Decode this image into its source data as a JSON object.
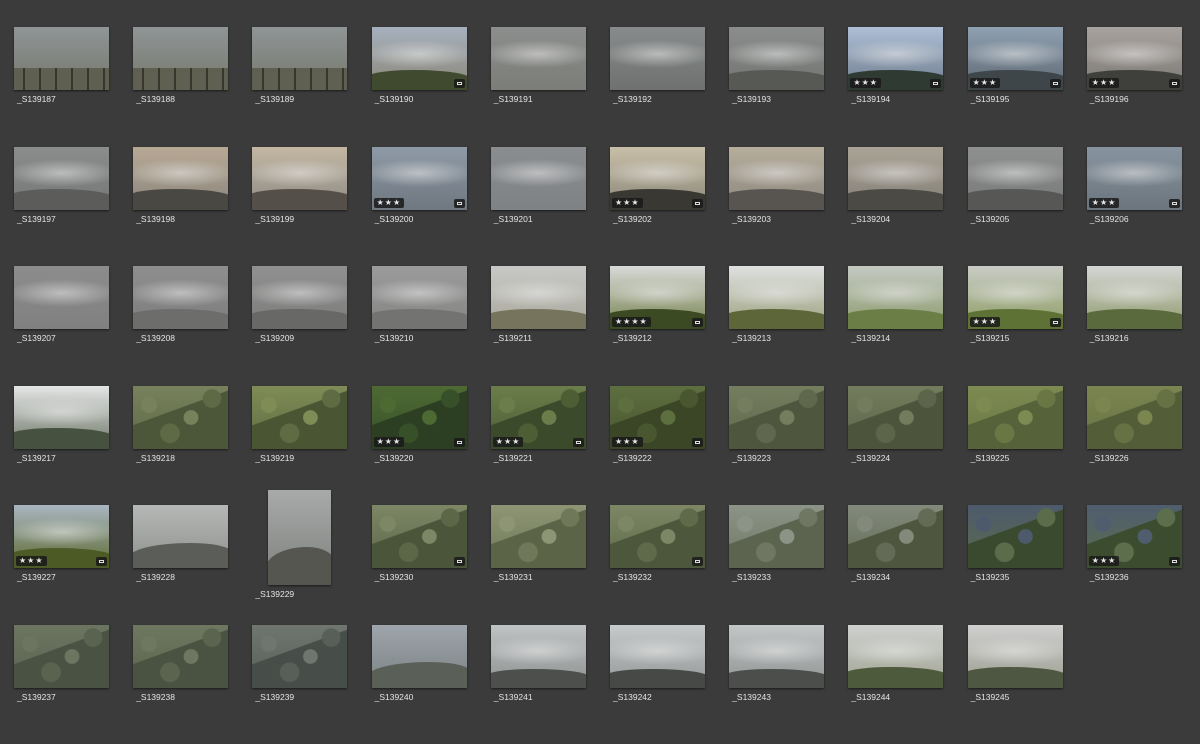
{
  "items": [
    {
      "name": "_S139187",
      "stars": "",
      "badge": false,
      "c": [
        "#8f9596",
        "#76786c"
      ],
      "h": "#5f5f52",
      "scene": "fence"
    },
    {
      "name": "_S139188",
      "stars": "",
      "badge": false,
      "c": [
        "#8f9596",
        "#76786c"
      ],
      "h": "#5f5f52",
      "scene": "fence"
    },
    {
      "name": "_S139189",
      "stars": "",
      "badge": false,
      "c": [
        "#8f9596",
        "#76786c"
      ],
      "h": "#5f5f52",
      "scene": "fence"
    },
    {
      "name": "_S139190",
      "stars": "",
      "badge": true,
      "c": [
        "#a6b0be",
        "#8b8676"
      ],
      "h": "#3f4a2e",
      "scene": "hills"
    },
    {
      "name": "_S139191",
      "stars": "",
      "badge": false,
      "c": [
        "#8c8e8d",
        "#7b7d78"
      ],
      "h": "#6e706b",
      "scene": "fog"
    },
    {
      "name": "_S139192",
      "stars": "",
      "badge": false,
      "c": [
        "#888b8c",
        "#6f7170"
      ],
      "h": "#555855",
      "scene": "fog"
    },
    {
      "name": "_S139193",
      "stars": "",
      "badge": false,
      "c": [
        "#8a8d8c",
        "#727471"
      ],
      "h": "#575a54",
      "scene": "trees"
    },
    {
      "name": "_S139194",
      "stars": "★★★",
      "badge": true,
      "c": [
        "#aebfd6",
        "#6e7c8c"
      ],
      "h": "#2f3a33",
      "scene": "trees"
    },
    {
      "name": "_S139195",
      "stars": "★★★",
      "badge": true,
      "c": [
        "#8fa0b2",
        "#5f6a73"
      ],
      "h": "#3e464a",
      "scene": "hills"
    },
    {
      "name": "_S139196",
      "stars": "★★★",
      "badge": true,
      "c": [
        "#a8a29e",
        "#7b7874"
      ],
      "h": "#3f403b",
      "scene": "hills"
    },
    {
      "name": "_S139197",
      "stars": "",
      "badge": false,
      "c": [
        "#8b8c8c",
        "#757676"
      ],
      "h": "#5c5d5b",
      "scene": "trees"
    },
    {
      "name": "_S139198",
      "stars": "",
      "badge": false,
      "c": [
        "#b8a994",
        "#8a857d"
      ],
      "h": "#4a4843",
      "scene": "trees"
    },
    {
      "name": "_S139199",
      "stars": "",
      "badge": false,
      "c": [
        "#c3b7a2",
        "#8d8a84"
      ],
      "h": "#545049",
      "scene": "trees"
    },
    {
      "name": "_S139200",
      "stars": "★★★",
      "badge": true,
      "c": [
        "#8e9aa6",
        "#6f7780"
      ],
      "h": "#5f666c",
      "scene": "fog"
    },
    {
      "name": "_S139201",
      "stars": "",
      "badge": false,
      "c": [
        "#8a8d90",
        "#7f8285"
      ],
      "h": "#777a7d",
      "scene": "fog"
    },
    {
      "name": "_S139202",
      "stars": "★★★",
      "badge": true,
      "c": [
        "#c9bfa8",
        "#8a8678"
      ],
      "h": "#3a3833",
      "scene": "trees"
    },
    {
      "name": "_S139203",
      "stars": "",
      "badge": false,
      "c": [
        "#b6ad9c",
        "#8b877e"
      ],
      "h": "#585550",
      "scene": "trees"
    },
    {
      "name": "_S139204",
      "stars": "",
      "badge": false,
      "c": [
        "#aaa396",
        "#837f77"
      ],
      "h": "#4c4a45",
      "scene": "trees"
    },
    {
      "name": "_S139205",
      "stars": "",
      "badge": false,
      "c": [
        "#8f9090",
        "#777878"
      ],
      "h": "#575855",
      "scene": "trees"
    },
    {
      "name": "_S139206",
      "stars": "★★★",
      "badge": true,
      "c": [
        "#8794a0",
        "#6c757d"
      ],
      "h": "#5d656b",
      "scene": "fog"
    },
    {
      "name": "_S139207",
      "stars": "",
      "badge": false,
      "c": [
        "#8c8c8c",
        "#808080"
      ],
      "h": "#7a7a7a",
      "scene": "fog"
    },
    {
      "name": "_S139208",
      "stars": "",
      "badge": false,
      "c": [
        "#8e8e8e",
        "#7d7d7d"
      ],
      "h": "#6d6d6b",
      "scene": "trees"
    },
    {
      "name": "_S139209",
      "stars": "",
      "badge": false,
      "c": [
        "#909090",
        "#7c7c7b"
      ],
      "h": "#686866",
      "scene": "trees"
    },
    {
      "name": "_S139210",
      "stars": "",
      "badge": false,
      "c": [
        "#9b9b9b",
        "#848483"
      ],
      "h": "#737371",
      "scene": "trees"
    },
    {
      "name": "_S139211",
      "stars": "",
      "badge": false,
      "c": [
        "#c8c8c6",
        "#a9a89c"
      ],
      "h": "#76745d",
      "scene": "hills"
    },
    {
      "name": "_S139212",
      "stars": "★★★★",
      "badge": true,
      "c": [
        "#d8dad8",
        "#76824e"
      ],
      "h": "#3b4a22",
      "scene": "trees"
    },
    {
      "name": "_S139213",
      "stars": "",
      "badge": false,
      "c": [
        "#dfe1e0",
        "#9aa07c"
      ],
      "h": "#5c6638",
      "scene": "trees"
    },
    {
      "name": "_S139214",
      "stars": "",
      "badge": false,
      "c": [
        "#c4c9c2",
        "#8c9a6d"
      ],
      "h": "#6a7e45",
      "scene": "hills"
    },
    {
      "name": "_S139215",
      "stars": "★★★",
      "badge": true,
      "c": [
        "#c9ccc6",
        "#8d9c62"
      ],
      "h": "#5e7236",
      "scene": "hills"
    },
    {
      "name": "_S139216",
      "stars": "",
      "badge": false,
      "c": [
        "#d4d6d4",
        "#8f9a6d"
      ],
      "h": "#5a6a3d",
      "scene": "hills"
    },
    {
      "name": "_S139217",
      "stars": "",
      "badge": false,
      "c": [
        "#e4e5e6",
        "#6d7766"
      ],
      "h": "#465140",
      "scene": "trees"
    },
    {
      "name": "_S139218",
      "stars": "",
      "badge": false,
      "c": [
        "#77815c",
        "#5e6946"
      ],
      "h": "#4c5638",
      "scene": "forest"
    },
    {
      "name": "_S139219",
      "stars": "",
      "badge": false,
      "c": [
        "#7f8c56",
        "#5f6b42"
      ],
      "h": "#4a5533",
      "scene": "forest"
    },
    {
      "name": "_S139220",
      "stars": "★★★",
      "badge": true,
      "c": [
        "#4e6a33",
        "#37502a"
      ],
      "h": "#2c3f22",
      "scene": "forest"
    },
    {
      "name": "_S139221",
      "stars": "★★★",
      "badge": true,
      "c": [
        "#6a7d4a",
        "#4d5e35"
      ],
      "h": "#3b4a2b",
      "scene": "forest"
    },
    {
      "name": "_S139222",
      "stars": "★★★",
      "badge": true,
      "c": [
        "#5d6e3f",
        "#48572f"
      ],
      "h": "#3a4626",
      "scene": "forest"
    },
    {
      "name": "_S139223",
      "stars": "",
      "badge": false,
      "c": [
        "#757d5f",
        "#5f684c"
      ],
      "h": "#4e573e",
      "scene": "forest"
    },
    {
      "name": "_S139224",
      "stars": "",
      "badge": false,
      "c": [
        "#737c5c",
        "#5c6549"
      ],
      "h": "#4c553b",
      "scene": "forest"
    },
    {
      "name": "_S139225",
      "stars": "",
      "badge": false,
      "c": [
        "#7d8a51",
        "#6a7745"
      ],
      "h": "#56633a",
      "scene": "forest"
    },
    {
      "name": "_S139226",
      "stars": "",
      "badge": false,
      "c": [
        "#7b8550",
        "#677244"
      ],
      "h": "#535e38",
      "scene": "forest"
    },
    {
      "name": "_S139227",
      "stars": "★★★",
      "badge": true,
      "c": [
        "#a9b6c0",
        "#5e6b32"
      ],
      "h": "#4c5a26",
      "scene": "hills"
    },
    {
      "name": "_S139228",
      "stars": "",
      "badge": false,
      "c": [
        "#b5b8b6",
        "#8e918c"
      ],
      "h": "#5a5d58",
      "scene": "bay"
    },
    {
      "name": "_S139229",
      "stars": "",
      "badge": false,
      "c": [
        "#a7aaa9",
        "#7d807c"
      ],
      "h": "#54564f",
      "scene": "bay",
      "tall": true
    },
    {
      "name": "_S139230",
      "stars": "",
      "badge": true,
      "c": [
        "#7d8766",
        "#5c6748"
      ],
      "h": "#4b553a",
      "scene": "slope"
    },
    {
      "name": "_S139231",
      "stars": "",
      "badge": false,
      "c": [
        "#8d9574",
        "#6f7858"
      ],
      "h": "#5b6447",
      "scene": "slope"
    },
    {
      "name": "_S139232",
      "stars": "",
      "badge": true,
      "c": [
        "#7d8766",
        "#5e6a49"
      ],
      "h": "#4c573b",
      "scene": "slope"
    },
    {
      "name": "_S139233",
      "stars": "",
      "badge": false,
      "c": [
        "#8c9488",
        "#6f7763"
      ],
      "h": "#5c6450",
      "scene": "slope"
    },
    {
      "name": "_S139234",
      "stars": "",
      "badge": false,
      "c": [
        "#838a7c",
        "#636a55"
      ],
      "h": "#4f563f",
      "scene": "slope"
    },
    {
      "name": "_S139235",
      "stars": "",
      "badge": false,
      "c": [
        "#4d5a6c",
        "#5a6c4a"
      ],
      "h": "#3a4a2e",
      "scene": "forest"
    },
    {
      "name": "_S139236",
      "stars": "★★★",
      "badge": true,
      "c": [
        "#4f5d6f",
        "#5c6e4b"
      ],
      "h": "#3c4c2f",
      "scene": "forest"
    },
    {
      "name": "_S139237",
      "stars": "",
      "badge": false,
      "c": [
        "#6b7560",
        "#596350"
      ],
      "h": "#4a5343",
      "scene": "forest"
    },
    {
      "name": "_S139238",
      "stars": "",
      "badge": false,
      "c": [
        "#6e7860",
        "#5a644e"
      ],
      "h": "#4a5341",
      "scene": "forest"
    },
    {
      "name": "_S139239",
      "stars": "",
      "badge": false,
      "c": [
        "#6f7670",
        "#585f59"
      ],
      "h": "#474d48",
      "scene": "slope"
    },
    {
      "name": "_S139240",
      "stars": "",
      "badge": false,
      "c": [
        "#9ea5ac",
        "#7b8282"
      ],
      "h": "#5a5f58",
      "scene": "bay"
    },
    {
      "name": "_S139241",
      "stars": "",
      "badge": false,
      "c": [
        "#bfc3c4",
        "#8e9190"
      ],
      "h": "#4c4f4c",
      "scene": "clouds"
    },
    {
      "name": "_S139242",
      "stars": "",
      "badge": false,
      "c": [
        "#c6cacb",
        "#949796"
      ],
      "h": "#464946",
      "scene": "clouds"
    },
    {
      "name": "_S139243",
      "stars": "",
      "badge": false,
      "c": [
        "#c3c7c8",
        "#8f9291"
      ],
      "h": "#4b4e4b",
      "scene": "clouds"
    },
    {
      "name": "_S139244",
      "stars": "",
      "badge": false,
      "c": [
        "#cfd1d0",
        "#9ea28f"
      ],
      "h": "#4d5a3c",
      "scene": "trees"
    },
    {
      "name": "_S139245",
      "stars": "",
      "badge": false,
      "c": [
        "#cfd0cf",
        "#9a9c8e"
      ],
      "h": "#4e5741",
      "scene": "hills"
    }
  ]
}
